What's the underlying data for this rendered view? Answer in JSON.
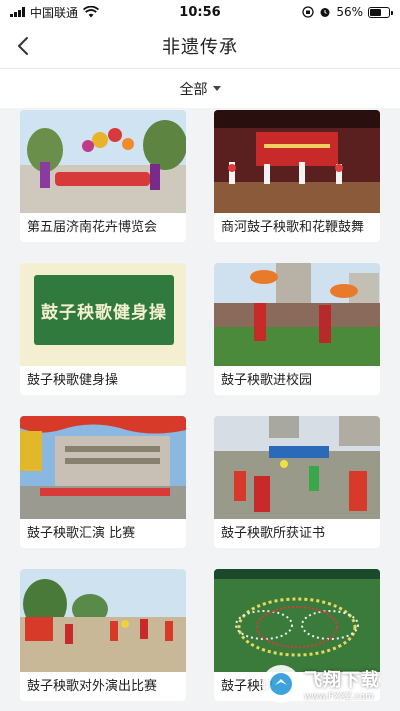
{
  "status_bar": {
    "carrier": "中国联通",
    "time": "10:56",
    "battery": "56%",
    "battery_level": 0.56,
    "icons": [
      "signal-icon",
      "wifi-icon",
      "orientation-lock-icon",
      "alarm-icon",
      "battery-icon"
    ]
  },
  "nav": {
    "title": "非遗传承",
    "back_icon": "chevron-left-icon"
  },
  "filter": {
    "selected": "全部",
    "icon": "caret-down-icon"
  },
  "cards": [
    {
      "label": "第五届济南花卉博览会"
    },
    {
      "label": "商河鼓子秧歌和花鞭鼓舞"
    },
    {
      "label": "鼓子秧歌健身操",
      "banner_text": "鼓子秧歌健身操"
    },
    {
      "label": "鼓子秧歌进校园"
    },
    {
      "label": "鼓子秧歌汇演 比赛"
    },
    {
      "label": "鼓子秧歌所获证书"
    },
    {
      "label": "鼓子秧歌对外演出比赛"
    },
    {
      "label": "鼓子秧歌"
    }
  ],
  "watermark": {
    "main": "飞翔下载",
    "sub": "www.FXXZ.com"
  },
  "colors": {
    "background": "#f2f3f5",
    "card": "#ffffff",
    "text": "#222222",
    "banner_green": "#2f7a3c",
    "banner_cream": "#f3efd0"
  }
}
